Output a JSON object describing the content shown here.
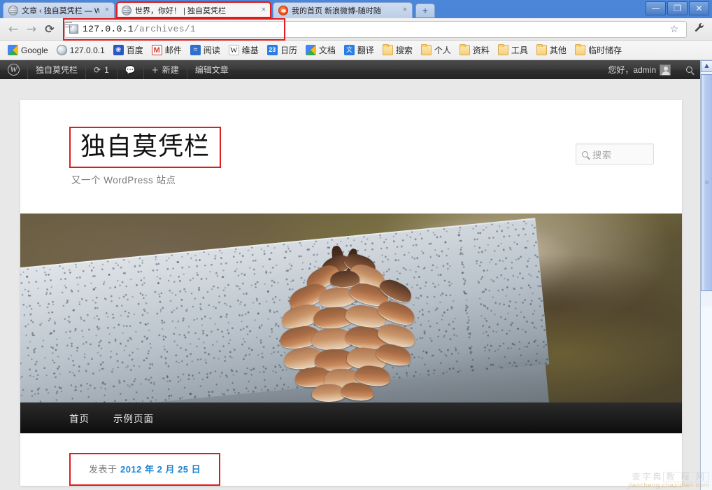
{
  "browser": {
    "tabs": [
      {
        "title": "文章 ‹ 独自莫凭栏 — Wor",
        "favicon": "globe-icon",
        "active": false,
        "highlighted": false,
        "close_label": "×"
      },
      {
        "title": "世界，你好！  |  独自莫凭栏",
        "favicon": "globe-icon",
        "active": true,
        "highlighted": true,
        "close_label": "×"
      },
      {
        "title": "我的首页 新浪微博-随时随",
        "favicon": "weibo-icon",
        "active": false,
        "highlighted": false,
        "close_label": "×"
      }
    ],
    "new_tab_label": "+",
    "window_controls": {
      "minimize": "—",
      "restore": "❐",
      "close": "✕"
    },
    "nav": {
      "back": "←",
      "forward": "→",
      "reload": "⟳"
    },
    "omnibox": {
      "url_host": "127.0.0.1",
      "url_path": "/archives/1",
      "favicon": "globe-icon",
      "star_label": "☆",
      "menu_label": "🔧"
    },
    "bookmarks": [
      {
        "label": "Google",
        "icon": "google-icon"
      },
      {
        "label": "127.0.0.1",
        "icon": "globe-icon"
      },
      {
        "label": "百度",
        "icon": "baidu-icon"
      },
      {
        "label": "邮件",
        "icon": "mail-icon"
      },
      {
        "label": "阅读",
        "icon": "reader-icon"
      },
      {
        "label": "维基",
        "icon": "wikipedia-icon"
      },
      {
        "label": "日历",
        "icon": "calendar-icon"
      },
      {
        "label": "文档",
        "icon": "google-icon"
      },
      {
        "label": "翻译",
        "icon": "translate-icon"
      },
      {
        "label": "搜索",
        "icon": "folder-icon"
      },
      {
        "label": "个人",
        "icon": "folder-icon"
      },
      {
        "label": "资料",
        "icon": "folder-icon"
      },
      {
        "label": "工具",
        "icon": "folder-icon"
      },
      {
        "label": "其他",
        "icon": "folder-icon"
      },
      {
        "label": "临时储存",
        "icon": "folder-icon"
      }
    ]
  },
  "adminbar": {
    "logo": "W",
    "site_name": "独自莫凭栏",
    "updates_icon": "refresh-icon",
    "updates_count": "1",
    "comments_icon": "comment-icon",
    "new_icon": "+",
    "new_label": "新建",
    "edit_post_label": "编辑文章",
    "greeting": "您好，admin",
    "search_icon": "search-icon"
  },
  "site": {
    "title": "独自莫凭栏",
    "description": "又一个 WordPress 站点",
    "search": {
      "placeholder": "搜索",
      "icon": "search-icon"
    },
    "nav_items": [
      {
        "label": "首页"
      },
      {
        "label": "示例页面"
      }
    ],
    "header_image_alt": "pinecone-on-granite-header"
  },
  "post": {
    "meta_prefix": "发表于",
    "date": "2012 年 2 月 25 日"
  },
  "watermark": {
    "line1": "查字典",
    "line1b": "教 程 网",
    "line2": "jiaocheng.chazidian.com"
  },
  "colors": {
    "highlight_red": "#e01b1b",
    "link_blue": "#1982d1",
    "adminbar_dark": "#232323",
    "nav_black": "#0d0d0d"
  }
}
